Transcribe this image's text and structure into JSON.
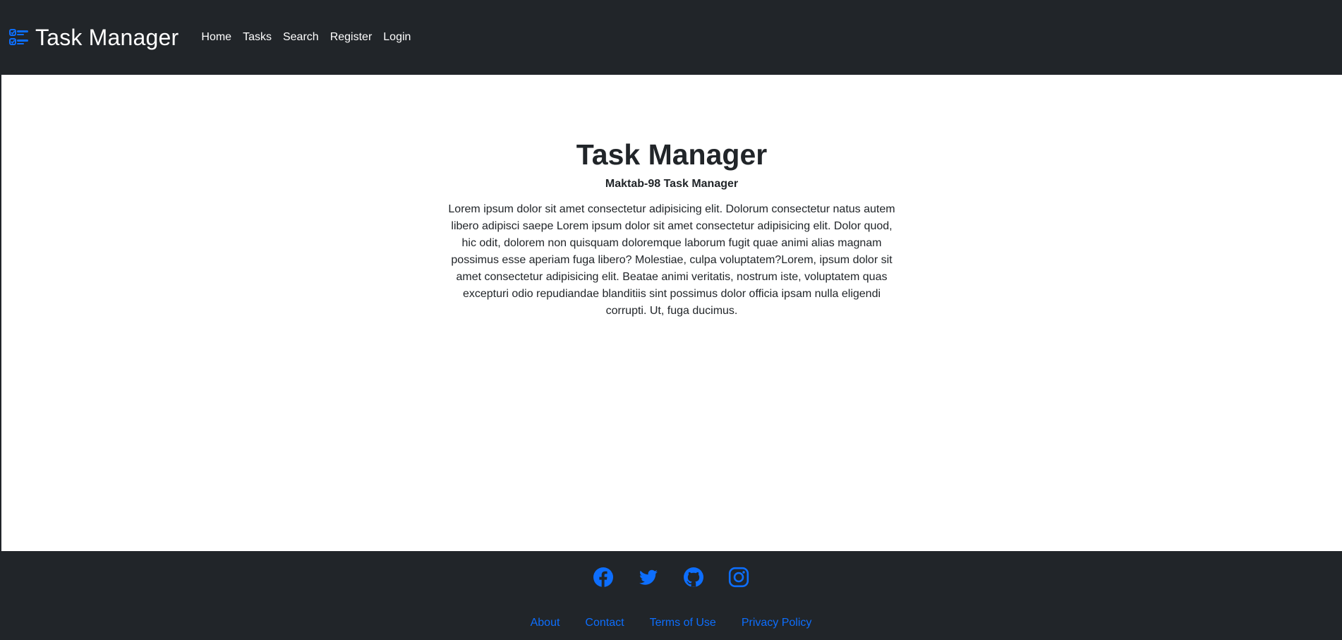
{
  "navbar": {
    "brand_icon": "list-check-icon",
    "brand_text": "Task Manager",
    "links": [
      {
        "label": "Home"
      },
      {
        "label": "Tasks"
      },
      {
        "label": "Search"
      },
      {
        "label": "Register"
      },
      {
        "label": "Login"
      }
    ]
  },
  "hero": {
    "title": "Task Manager",
    "subtitle": "Maktab-98 Task Manager",
    "text": "Lorem ipsum dolor sit amet consectetur adipisicing elit. Dolorum consectetur natus autem libero adipisci saepe Lorem ipsum dolor sit amet consectetur adipisicing elit. Dolor quod, hic odit, dolorem non quisquam doloremque laborum fugit quae animi alias magnam possimus esse aperiam fuga libero? Molestiae, culpa voluptatem?Lorem, ipsum dolor sit amet consectetur adipisicing elit. Beatae animi veritatis, nostrum iste, voluptatem quas excepturi odio repudiandae blanditiis sint possimus dolor officia ipsam nulla eligendi corrupti. Ut, fuga ducimus."
  },
  "footer": {
    "social_icons": [
      "facebook-icon",
      "twitter-icon",
      "github-icon",
      "instagram-icon"
    ],
    "links": [
      {
        "label": "About"
      },
      {
        "label": "Contact"
      },
      {
        "label": "Terms of Use"
      },
      {
        "label": "Privacy Policy"
      }
    ]
  },
  "colors": {
    "dark": "#212529",
    "accent": "#0d6efd",
    "white": "#ffffff"
  }
}
